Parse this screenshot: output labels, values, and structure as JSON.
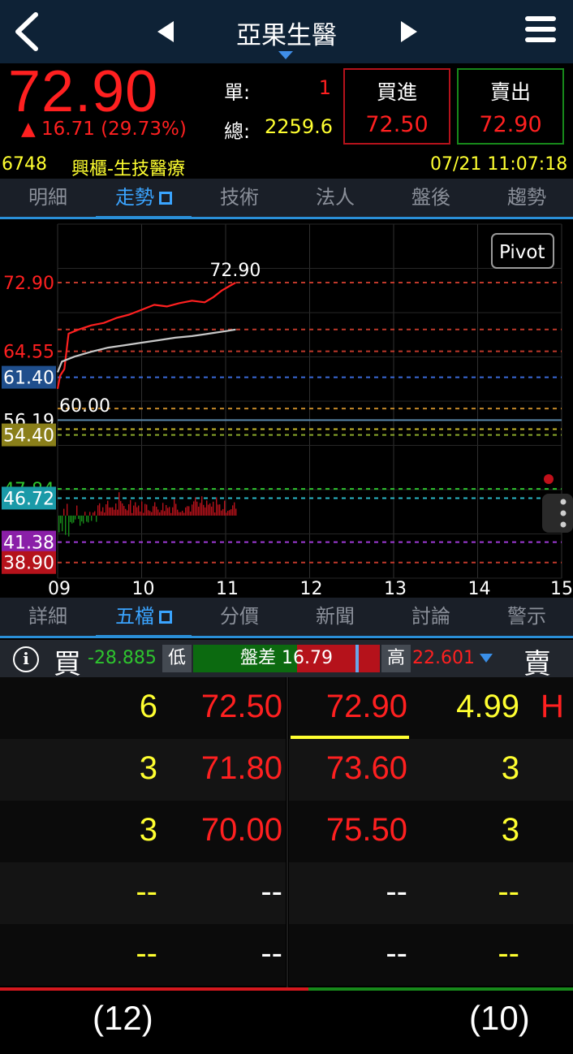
{
  "header": {
    "back_icon": "chevron-left-icon",
    "prev_icon": "triangle-left-icon",
    "next_icon": "triangle-right-icon",
    "title": "亞果生醫",
    "menu_icon": "hamburger-menu-icon"
  },
  "quote": {
    "price": "72.90",
    "change": "▲ 16.71 (29.73%)",
    "single_label": "單:",
    "single_value": "1",
    "total_label": "總:",
    "total_value": "2259.6",
    "buy_label": "買進",
    "buy_price": "72.50",
    "sell_label": "賣出",
    "sell_price": "72.90"
  },
  "info": {
    "code": "6748",
    "market": "興櫃-生技醫療",
    "datetime": "07/21 11:07:18"
  },
  "chart_tabs": [
    {
      "label": "明細"
    },
    {
      "label": "走勢",
      "active": true
    },
    {
      "label": "技術"
    },
    {
      "label": "法人"
    },
    {
      "label": "盤後"
    },
    {
      "label": "趨勢"
    }
  ],
  "chart_data": {
    "type": "line",
    "ylim": [
      37.0,
      80.0
    ],
    "xlim": [
      9.0,
      15.0
    ],
    "x_ticks": [
      "09",
      "10",
      "11",
      "12",
      "13",
      "14",
      "15"
    ],
    "pivot_label": "Pivot",
    "price_labels": [
      {
        "text": "72.90",
        "value": 72.9,
        "color": "#ff2020",
        "bg": ""
      },
      {
        "text": "64.55",
        "value": 64.55,
        "color": "#ff2020",
        "bg": ""
      },
      {
        "text": "61.40",
        "value": 61.4,
        "color": "#ffffff",
        "bg": "#1f4e8c"
      },
      {
        "text": "56.19",
        "value": 56.19,
        "color": "#ffffff",
        "bg": ""
      },
      {
        "text": "54.40",
        "value": 54.4,
        "color": "#ffffff",
        "bg": "#8a7f1a"
      },
      {
        "text": "47.84",
        "value": 47.84,
        "color": "#2ec42e",
        "bg": ""
      },
      {
        "text": "46.72",
        "value": 46.72,
        "color": "#ffffff",
        "bg": "#1a9aa8"
      },
      {
        "text": "41.38",
        "value": 41.38,
        "color": "#ffffff",
        "bg": "#8a1fa8"
      },
      {
        "text": "38.90",
        "value": 38.9,
        "color": "#ffffff",
        "bg": "#b5121b"
      }
    ],
    "reference_lines": [
      {
        "value": 72.9,
        "color": "#c0392b",
        "style": "dashed"
      },
      {
        "value": 67.2,
        "color": "#c0392b",
        "style": "dashed"
      },
      {
        "value": 64.55,
        "color": "#c0392b",
        "style": "dashed"
      },
      {
        "value": 61.4,
        "color": "#3a6ad8",
        "style": "dashed"
      },
      {
        "value": 56.19,
        "color": "#5a86a8",
        "style": "solid"
      },
      {
        "value": 57.6,
        "color": "#c78a2a",
        "style": "dashed"
      },
      {
        "value": 55.1,
        "color": "#c9b92a",
        "style": "dashed"
      },
      {
        "value": 54.4,
        "color": "#8aa82a",
        "style": "dashed"
      },
      {
        "value": 47.84,
        "color": "#2ec42e",
        "style": "dashed"
      },
      {
        "value": 46.72,
        "color": "#2ab8c8",
        "style": "dashed"
      },
      {
        "value": 41.38,
        "color": "#a03ad8",
        "style": "dashed"
      },
      {
        "value": 38.9,
        "color": "#c0392b",
        "style": "dashed"
      }
    ],
    "annotations": [
      {
        "text": "72.90",
        "x": 11.1,
        "value": 72.9
      },
      {
        "text": "60.00",
        "x": 9.0,
        "value": 60.0
      }
    ],
    "series": [
      {
        "color": "#ff2020",
        "points": [
          [
            9.0,
            60.0
          ],
          [
            9.03,
            61.6
          ],
          [
            9.08,
            62.4
          ],
          [
            9.13,
            66.7
          ],
          [
            9.25,
            67.2
          ],
          [
            9.4,
            67.7
          ],
          [
            9.55,
            68.0
          ],
          [
            9.7,
            68.6
          ],
          [
            9.85,
            69.0
          ],
          [
            10.0,
            69.6
          ],
          [
            10.15,
            70.2
          ],
          [
            10.3,
            70.0
          ],
          [
            10.45,
            70.4
          ],
          [
            10.6,
            70.7
          ],
          [
            10.75,
            70.5
          ],
          [
            10.85,
            71.1
          ],
          [
            10.95,
            71.9
          ],
          [
            11.05,
            72.5
          ],
          [
            11.12,
            72.9
          ]
        ]
      },
      {
        "color": "#c8c8c8",
        "points": [
          [
            9.0,
            62.0
          ],
          [
            9.05,
            63.3
          ],
          [
            9.2,
            63.9
          ],
          [
            9.4,
            64.5
          ],
          [
            9.6,
            65.0
          ],
          [
            9.8,
            65.3
          ],
          [
            10.0,
            65.6
          ],
          [
            10.2,
            65.9
          ],
          [
            10.4,
            66.2
          ],
          [
            10.6,
            66.4
          ],
          [
            10.8,
            66.7
          ],
          [
            11.0,
            67.0
          ],
          [
            11.12,
            67.2
          ]
        ]
      }
    ],
    "volume_baseline": 44.6,
    "volume_range": [
      9.0,
      11.12
    ]
  },
  "book_tabs": [
    {
      "label": "詳細"
    },
    {
      "label": "五檔",
      "active": true
    },
    {
      "label": "分價"
    },
    {
      "label": "新聞"
    },
    {
      "label": "討論"
    },
    {
      "label": "警示"
    }
  ],
  "orderbook": {
    "buy_label": "買",
    "sell_label": "賣",
    "low_value": "-28.885",
    "low_tag": "低",
    "spread_text": "盤差 16.79",
    "high_tag": "高",
    "high_value": "22.601",
    "rows": [
      {
        "bid_qty": "6",
        "bid_price": "72.50",
        "ask_price": "72.90",
        "ask_qty": "4.99",
        "flag": "H"
      },
      {
        "bid_qty": "3",
        "bid_price": "71.80",
        "ask_price": "73.60",
        "ask_qty": "3",
        "flag": ""
      },
      {
        "bid_qty": "3",
        "bid_price": "70.00",
        "ask_price": "75.50",
        "ask_qty": "3",
        "flag": ""
      },
      {
        "bid_qty": "--",
        "bid_price": "--",
        "ask_price": "--",
        "ask_qty": "--",
        "flag": ""
      },
      {
        "bid_qty": "--",
        "bid_price": "--",
        "ask_price": "--",
        "ask_qty": "--",
        "flag": ""
      }
    ],
    "total_bid": "(12)",
    "total_ask": "(10)"
  },
  "colors": {
    "up": "#ff2020",
    "down": "#2ec42e",
    "volume": "#ffff30",
    "accent": "#2a8fd8"
  }
}
